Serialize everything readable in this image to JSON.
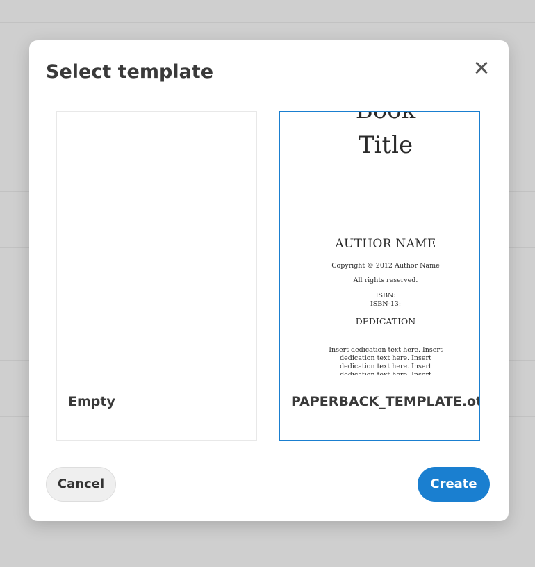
{
  "dialog": {
    "title": "Select template",
    "close_icon": "close-icon"
  },
  "templates": [
    {
      "label": "Empty",
      "selected": false
    },
    {
      "label": "PAPERBACK_TEMPLATE.ott",
      "selected": true,
      "preview": {
        "book_line": "Book",
        "title_line": "Title",
        "author": "AUTHOR NAME",
        "copyright": "Copyright © 2012 Author Name",
        "rights": "All rights reserved.",
        "isbn": "ISBN:",
        "isbn13": "ISBN-13:",
        "dedication_heading": "DEDICATION",
        "dedication_text": "Insert dedication text here. Insert dedication text here. Insert dedication text here. Insert dedication text here. Insert dedication text here. Insert dedication text here. Insert"
      }
    }
  ],
  "buttons": {
    "cancel": "Cancel",
    "create": "Create"
  },
  "colors": {
    "accent": "#1a7fd0",
    "backdrop": "#cfcfcf",
    "dialog_bg": "#ffffff"
  }
}
